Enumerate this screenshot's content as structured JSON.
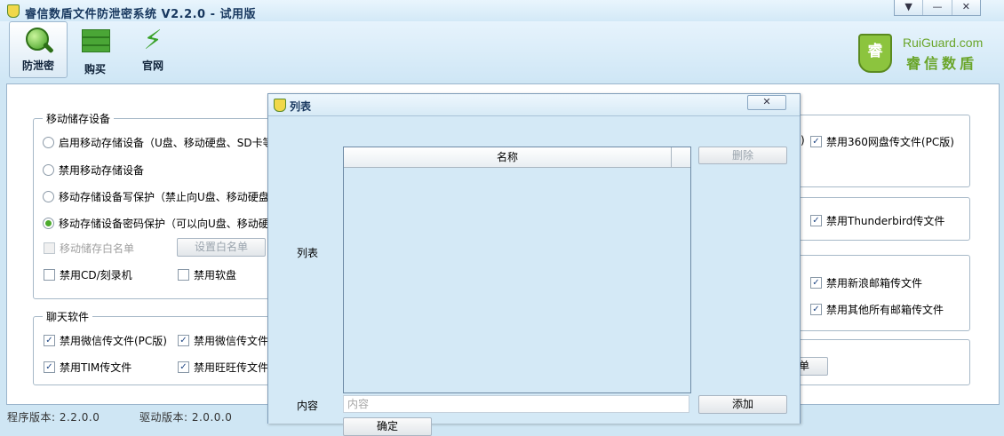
{
  "window": {
    "title": "睿信数盾文件防泄密系统 V2.2.0 - 试用版",
    "controls": {
      "dropdown": "▼",
      "minimize": "—",
      "close": "✕"
    }
  },
  "toolbar": {
    "items": [
      {
        "label": "防泄密",
        "icon": "magnifier-icon",
        "active": true
      },
      {
        "label": "购买",
        "icon": "wall-icon",
        "active": false
      },
      {
        "label": "官网",
        "icon": "lightning-icon",
        "active": false
      }
    ]
  },
  "brand": {
    "shield_char": "睿",
    "en": "RuiGuard.com",
    "cn": "睿信数盾"
  },
  "usb_group": {
    "legend": "移动储存设备",
    "options": [
      {
        "label": "启用移动存储设备（U盘、移动硬盘、SD卡等",
        "selected": false
      },
      {
        "label": "禁用移动存储设备",
        "selected": false
      },
      {
        "label": "移动存储设备写保护（禁止向U盘、移动硬盘",
        "selected": false
      },
      {
        "label": "移动存储设备密码保护（可以向U盘、移动硬",
        "selected": true
      }
    ],
    "whitelist_label": "移动储存白名单",
    "whitelist_button": "设置白名单",
    "cd_label": "禁用CD/刻录机",
    "floppy_label": "禁用软盘"
  },
  "chat_group": {
    "legend": "聊天软件",
    "items": [
      {
        "label": "禁用微信传文件(PC版)",
        "checked": true
      },
      {
        "label": "禁用微信传文件",
        "checked": true
      },
      {
        "label": "禁用TIM传文件",
        "checked": true
      },
      {
        "label": "禁用旺旺传文件",
        "checked": true
      }
    ]
  },
  "right_groups": {
    "netdisk_partial": ")",
    "netdisk_label": "禁用360网盘传文件(PC版)",
    "thunderbird_label": "禁用Thunderbird传文件",
    "sina_label": "禁用新浪邮箱传文件",
    "other_mail_label": "禁用其他所有邮箱传文件",
    "partial_button": "单"
  },
  "status": {
    "program_version": "程序版本: 2.2.0.0",
    "driver_version": "驱动版本: 2.0.0.0"
  },
  "dialog": {
    "title": "列表",
    "close": "✕",
    "list_label": "列表",
    "column_name": "名称",
    "delete_button": "删除",
    "content_label": "内容",
    "content_placeholder": "内容",
    "add_button": "添加",
    "ok_button": "确定"
  }
}
